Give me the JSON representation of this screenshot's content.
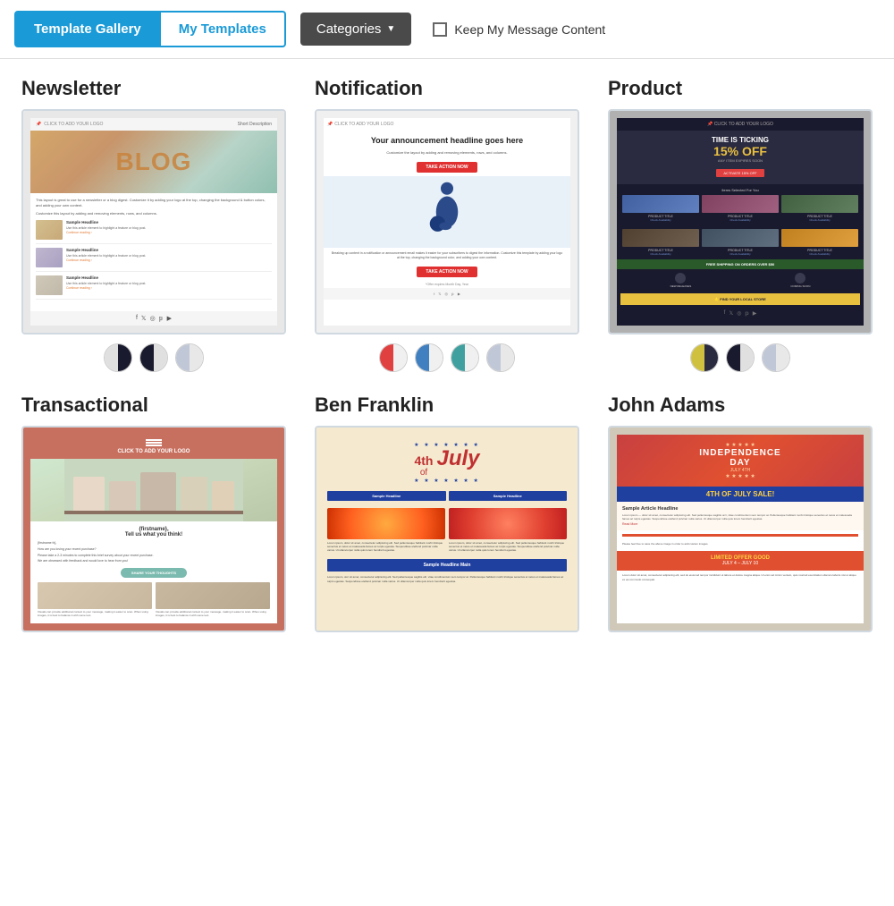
{
  "header": {
    "tab_gallery": "Template Gallery",
    "tab_my_templates": "My Templates",
    "btn_categories": "Categories",
    "keep_message_label": "Keep My Message Content"
  },
  "sections": [
    {
      "id": "newsletter",
      "title": "Newsletter",
      "swatches": [
        {
          "left": "#e0e0e0",
          "right": "#1a1a2e"
        },
        {
          "left": "#1a1a2e",
          "right": "#e0e0e0"
        },
        {
          "left": "#c0c8d8",
          "right": "#e8e8e8"
        }
      ]
    },
    {
      "id": "notification",
      "title": "Notification",
      "swatches": [
        {
          "left": "#e04040",
          "right": "#f0f0f0"
        },
        {
          "left": "#4080c0",
          "right": "#f0f0f0"
        },
        {
          "left": "#40a0a0",
          "right": "#f0f0f0"
        },
        {
          "left": "#c0c8d8",
          "right": "#e8e8e8"
        }
      ]
    },
    {
      "id": "product",
      "title": "Product",
      "swatches": [
        {
          "left": "#d0c040",
          "right": "#2a2a40"
        },
        {
          "left": "#2a2a40",
          "right": "#e0e0e0"
        },
        {
          "left": "#c0c8d8",
          "right": "#e8e8e8"
        }
      ]
    },
    {
      "id": "transactional",
      "title": "Transactional",
      "swatches": []
    },
    {
      "id": "ben-franklin",
      "title": "Ben Franklin",
      "swatches": []
    },
    {
      "id": "john-adams",
      "title": "John Adams",
      "swatches": []
    }
  ]
}
